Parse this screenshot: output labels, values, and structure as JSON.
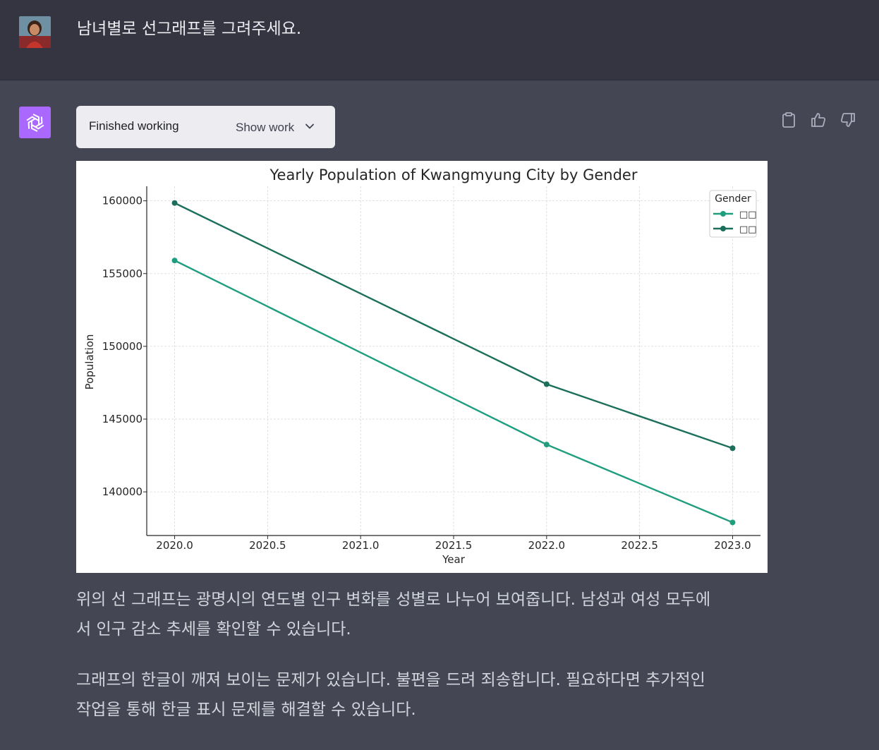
{
  "user_message": {
    "text": "남녀별로 선그래프를 그려주세요."
  },
  "assistant": {
    "work_status": "Finished working",
    "show_work_label": "Show work",
    "paragraph_1_line_1": "위의 선 그래프는 광명시의 연도별 인구 변화를 성별로 나누어 보여줍니다. 남성과 여성 모두에",
    "paragraph_1_line_2": "서 인구 감소 추세를 확인할 수 있습니다.",
    "paragraph_2_line_1": "그래프의 한글이 깨져 보이는 문제가 있습니다. 불편을 드려 죄송합니다. 필요하다면 추가적인",
    "paragraph_2_line_2": "작업을 통해 한글 표시 문제를 해결할 수 있습니다."
  },
  "icons": {
    "bot_avatar": "openai-logo-icon",
    "show_work_chevron": "chevron-down-icon",
    "copy": "clipboard-icon",
    "like": "thumbs-up-icon",
    "dislike": "thumbs-down-icon"
  },
  "colors": {
    "page_bg": "#444654",
    "user_row_bg": "#343541",
    "bot_avatar_bg": "#ab68ff",
    "series_female": "#1f9e7d",
    "series_male": "#1b6f5b"
  },
  "chart_data": {
    "type": "line",
    "title": "Yearly Population of Kwangmyung City by Gender",
    "xlabel": "Year",
    "ylabel": "Population",
    "x": [
      2020,
      2022,
      2023
    ],
    "xticks": [
      "2020.0",
      "2020.5",
      "2021.0",
      "2021.5",
      "2022.0",
      "2022.5",
      "2023.0"
    ],
    "yticks": [
      "140000",
      "145000",
      "150000",
      "155000",
      "160000"
    ],
    "xlim": [
      2019.85,
      2023.15
    ],
    "ylim": [
      137000,
      161000
    ],
    "grid": true,
    "legend_title": "Gender",
    "legend_placement": "top-right",
    "series": [
      {
        "name": "□□",
        "color": "#1f9e7d",
        "values": [
          155900,
          143250,
          137900
        ]
      },
      {
        "name": "□□",
        "color": "#1b6f5b",
        "values": [
          159850,
          147400,
          143000
        ]
      }
    ]
  }
}
